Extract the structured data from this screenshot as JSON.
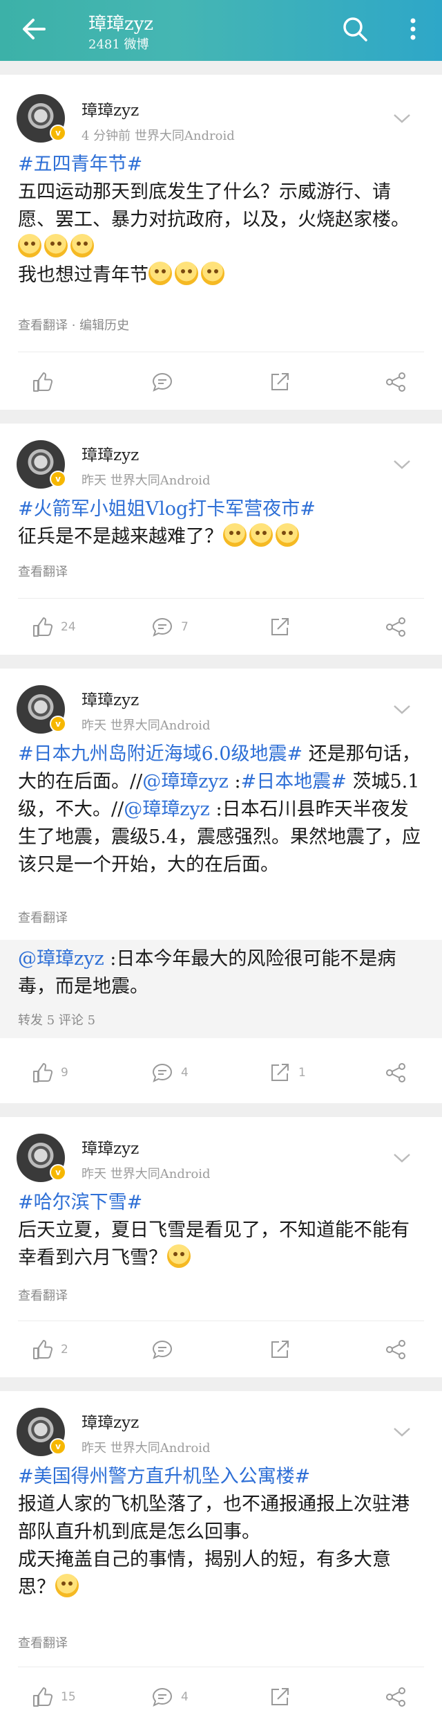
{
  "header": {
    "title": "璋璋zyz",
    "subtitle": "2481 微博",
    "icons": [
      "back-arrow-icon",
      "search-icon",
      "more-vertical-icon"
    ]
  },
  "posts": [
    {
      "user": "璋璋zyz",
      "meta": "4 分钟前    世界大同Android",
      "tag": "#五四青年节#",
      "text1": "五四运动那天到底发生了什么？示威游行、请愿、罢工、暴力对抗政府，以及，火烧赵家楼。",
      "text2": "我也想过青年节",
      "footer": "查看翻译   ·   编辑历史",
      "likes": "",
      "comments": "",
      "reposts": ""
    },
    {
      "user": "璋璋zyz",
      "meta": "昨天    世界大同Android",
      "tag": "#火箭军小姐姐Vlog打卡军营夜市#",
      "text1": "征兵是不是越来越难了？",
      "footer": "查看翻译",
      "likes": "24",
      "comments": "7",
      "reposts": ""
    },
    {
      "user": "璋璋zyz",
      "meta": "昨天    世界大同Android",
      "tag": "#日本九州岛附近海域6.0级地震#",
      "text1": " 还是那句话，大的在后面。//",
      "mention1": "@璋璋zyz",
      "text2": " :",
      "tag2": "#日本地震#",
      "text3": " 茨城5.1级，不大。//",
      "mention2": "@璋璋zyz",
      "text4": " :日本石川县昨天半夜发生了地震，震级5.4，震感强烈。果然地震了，应该只是一个开始，大的在后面。",
      "footer": "查看翻译",
      "repost_mention": "@璋璋zyz",
      "repost_text": " :日本今年最大的风险很可能不是病毒，而是地震。",
      "repost_stats": "转发 5    评论 5",
      "likes": "9",
      "comments": "4",
      "reposts": "1"
    },
    {
      "user": "璋璋zyz",
      "meta": "昨天    世界大同Android",
      "tag": "#哈尔滨下雪#",
      "text1": "后天立夏，夏日飞雪是看见了，不知道能不能有幸看到六月飞雪？",
      "footer": "查看翻译",
      "likes": "2",
      "comments": "",
      "reposts": ""
    },
    {
      "user": "璋璋zyz",
      "meta": "昨天    世界大同Android",
      "tag": "#美国得州警方直升机坠入公寓楼#",
      "text1": "报道人家的飞机坠落了，也不通报通报上次驻港部队直升机到底是怎么回事。",
      "text2": "成天掩盖自己的事情，揭别人的短，有多大意思？",
      "footer": "查看翻译",
      "likes": "15",
      "comments": "4",
      "reposts": ""
    }
  ],
  "colors": {
    "header_start": "#3cb1a8",
    "header_end": "#2ea7c8",
    "link": "#2e6fd6",
    "meta": "#9c9c9c"
  }
}
